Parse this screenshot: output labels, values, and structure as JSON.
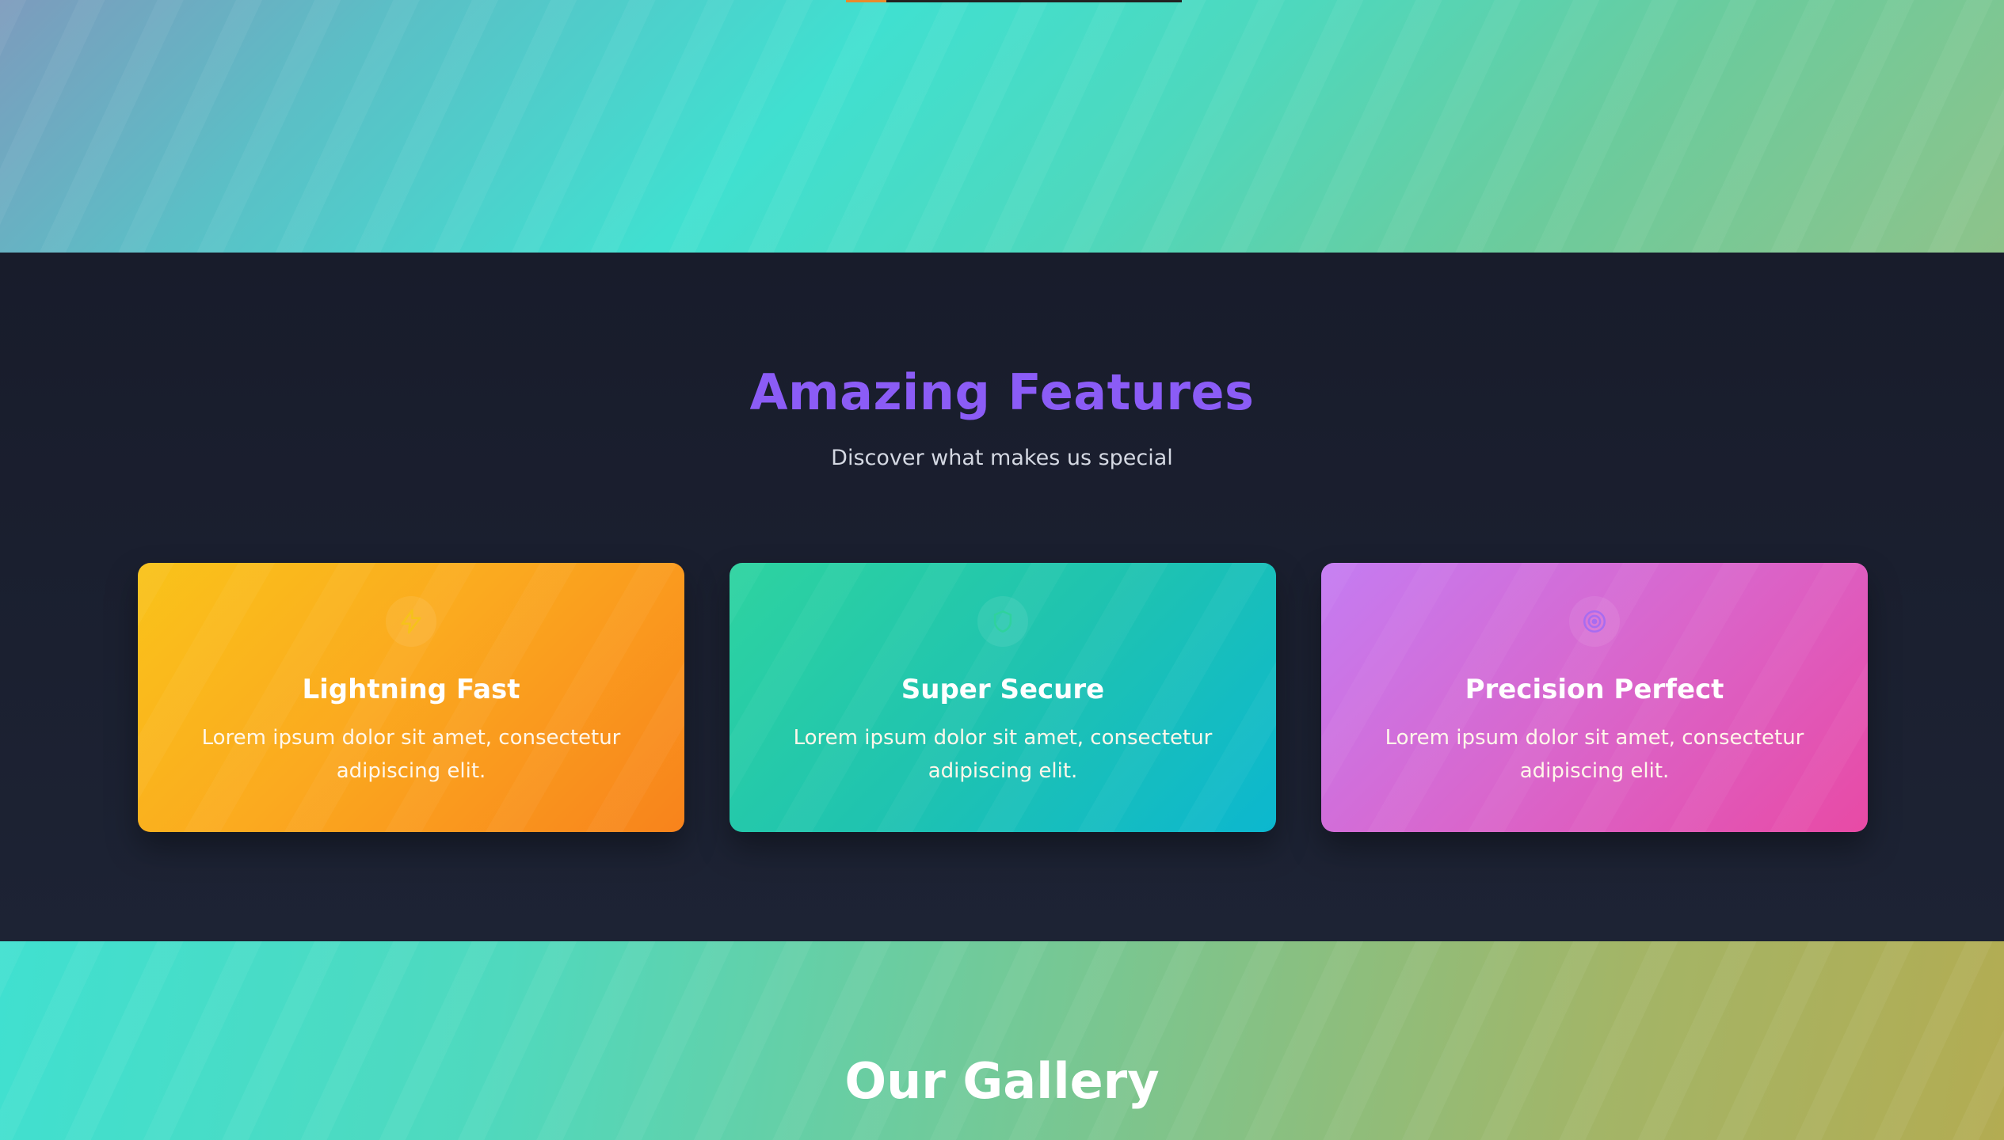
{
  "hero": {
    "progress_fraction": 0.12,
    "accent_color": "#e98a2c"
  },
  "features": {
    "title": "Amazing Features",
    "subtitle": "Discover what makes us special",
    "title_color": "#8b5cf6",
    "cards": [
      {
        "icon": "lightning-icon",
        "title": "Lightning Fast",
        "text": "Lorem ipsum dolor sit amet, consectetur adipiscing elit.",
        "gradient": [
          "#f9c31a",
          "#f8831c"
        ]
      },
      {
        "icon": "shield-icon",
        "title": "Super Secure",
        "text": "Lorem ipsum dolor sit amet, consectetur adipiscing elit.",
        "gradient": [
          "#2ed3a0",
          "#0cb7cf"
        ]
      },
      {
        "icon": "target-icon",
        "title": "Precision Perfect",
        "text": "Lorem ipsum dolor sit amet, consectetur adipiscing elit.",
        "gradient": [
          "#c47cf2",
          "#e84aa5"
        ]
      }
    ]
  },
  "gallery": {
    "title": "Our Gallery"
  }
}
